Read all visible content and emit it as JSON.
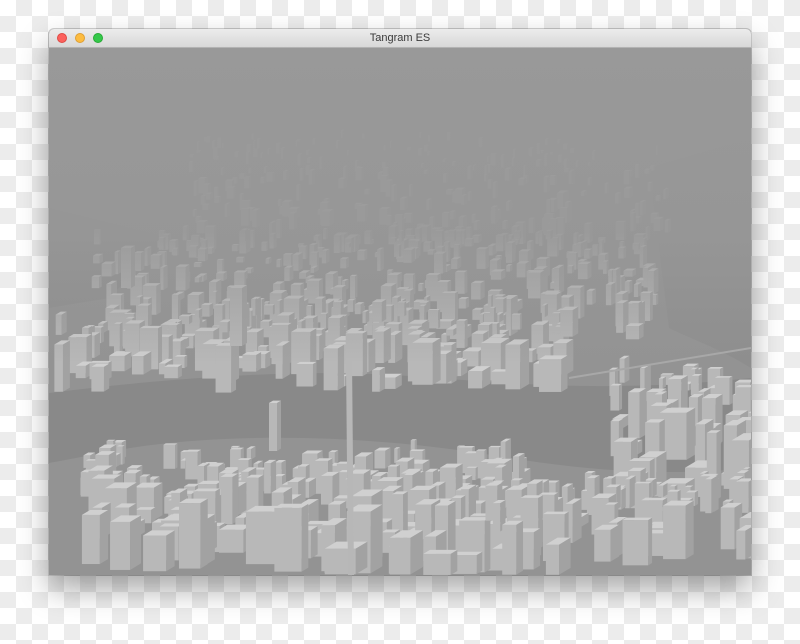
{
  "window": {
    "title": "Tangram ES",
    "controls": [
      "close",
      "minimize",
      "zoom"
    ]
  },
  "map": {
    "description_icon": "city-3d-render",
    "colors": {
      "fog": "#979797",
      "water": "#8a8a8a",
      "land": "#939393",
      "building_light": "#d0d0d0",
      "building_mid": "#b8b8b8",
      "building_shadow": "#a2a2a2"
    }
  }
}
